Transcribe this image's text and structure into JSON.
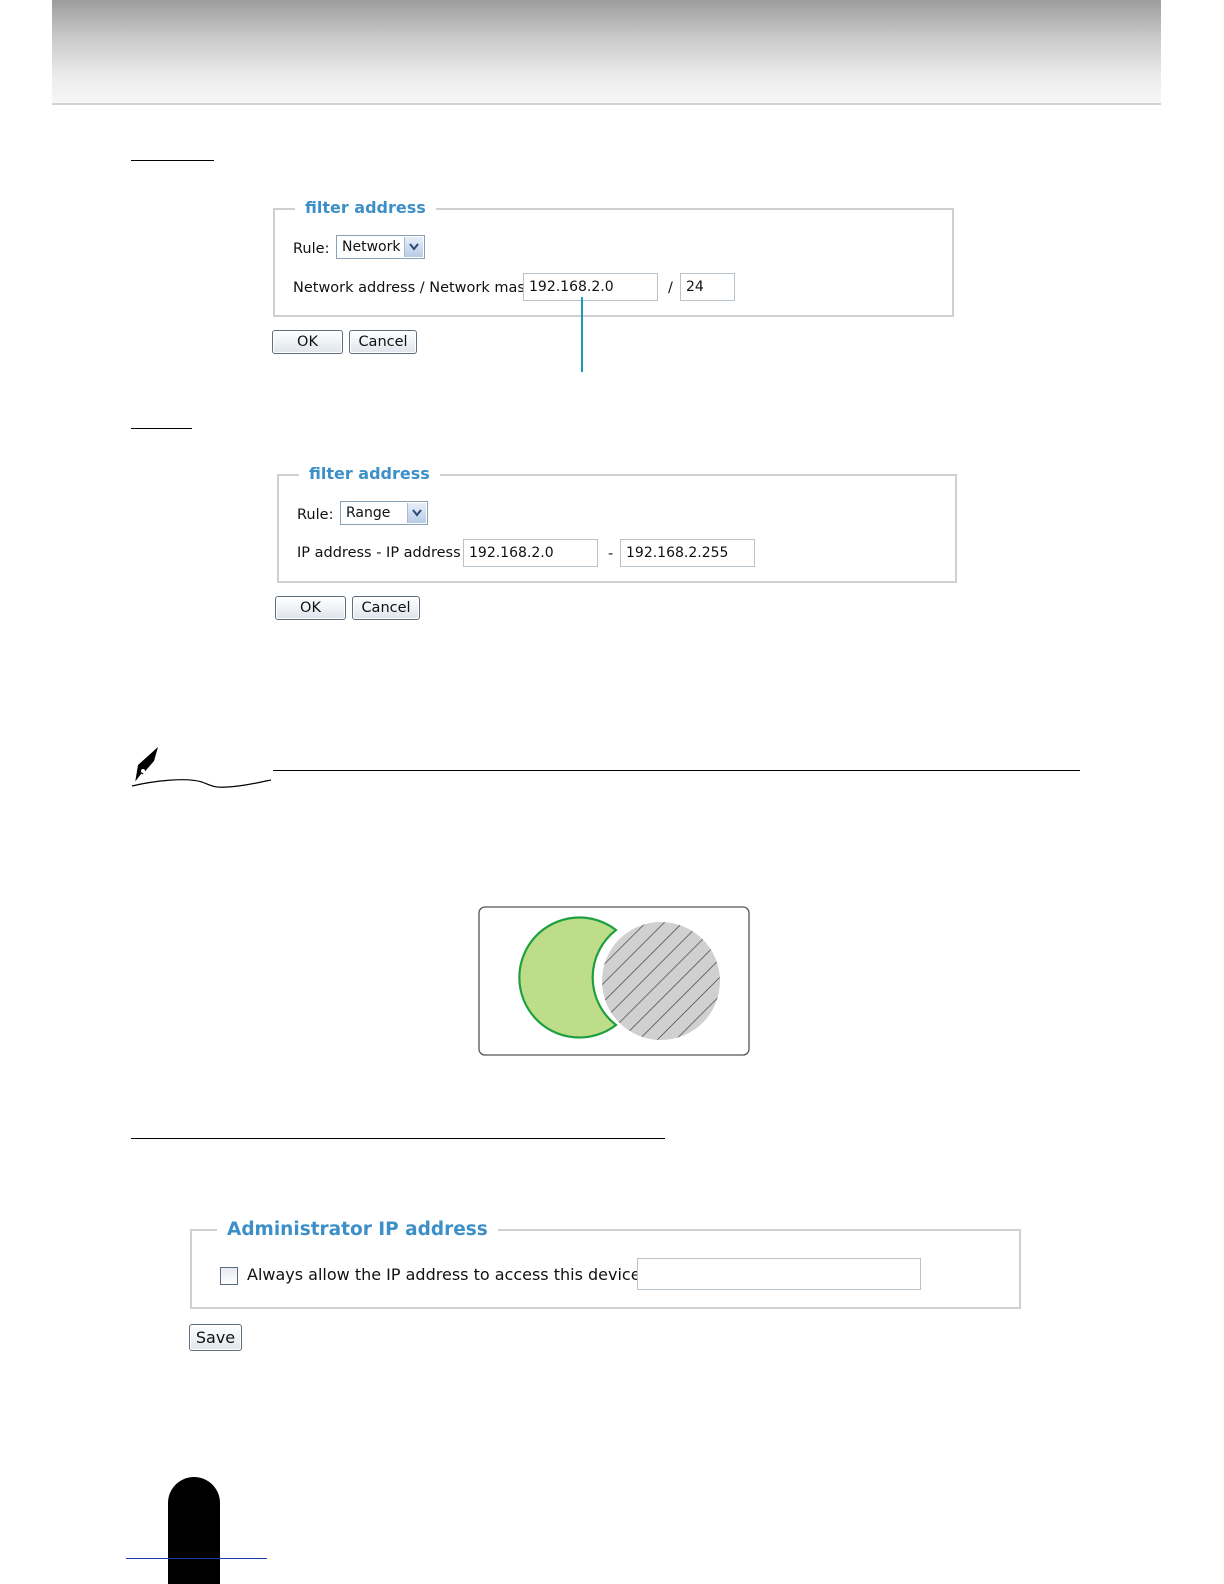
{
  "network_panel": {
    "legend": "filter address",
    "rule_label": "Rule:",
    "rule_value": "Network",
    "address_label": "Network address / Network mask",
    "address_value": "192.168.2.0",
    "separator": "/",
    "mask_value": "24",
    "ok_label": "OK",
    "cancel_label": "Cancel"
  },
  "range_panel": {
    "legend": "filter address",
    "rule_label": "Rule:",
    "rule_value": "Range",
    "address_label": "IP address - IP address",
    "start_value": "192.168.2.0",
    "separator": "-",
    "end_value": "192.168.2.255",
    "ok_label": "OK",
    "cancel_label": "Cancel"
  },
  "admin_panel": {
    "legend": "Administrator IP address",
    "checkbox_label": "Always allow the IP address to access this device",
    "checkbox_checked": false,
    "ip_value": "",
    "save_label": "Save"
  },
  "diagram": {
    "allowed_fill": "#bedd8a",
    "allowed_stroke": "#1fa03f",
    "denied_fill": "#d0d0d0",
    "hatch_color": "#4a4a4a"
  },
  "icons": {
    "note": "pen-nib-icon",
    "select_arrow": "chevron-down-icon"
  }
}
